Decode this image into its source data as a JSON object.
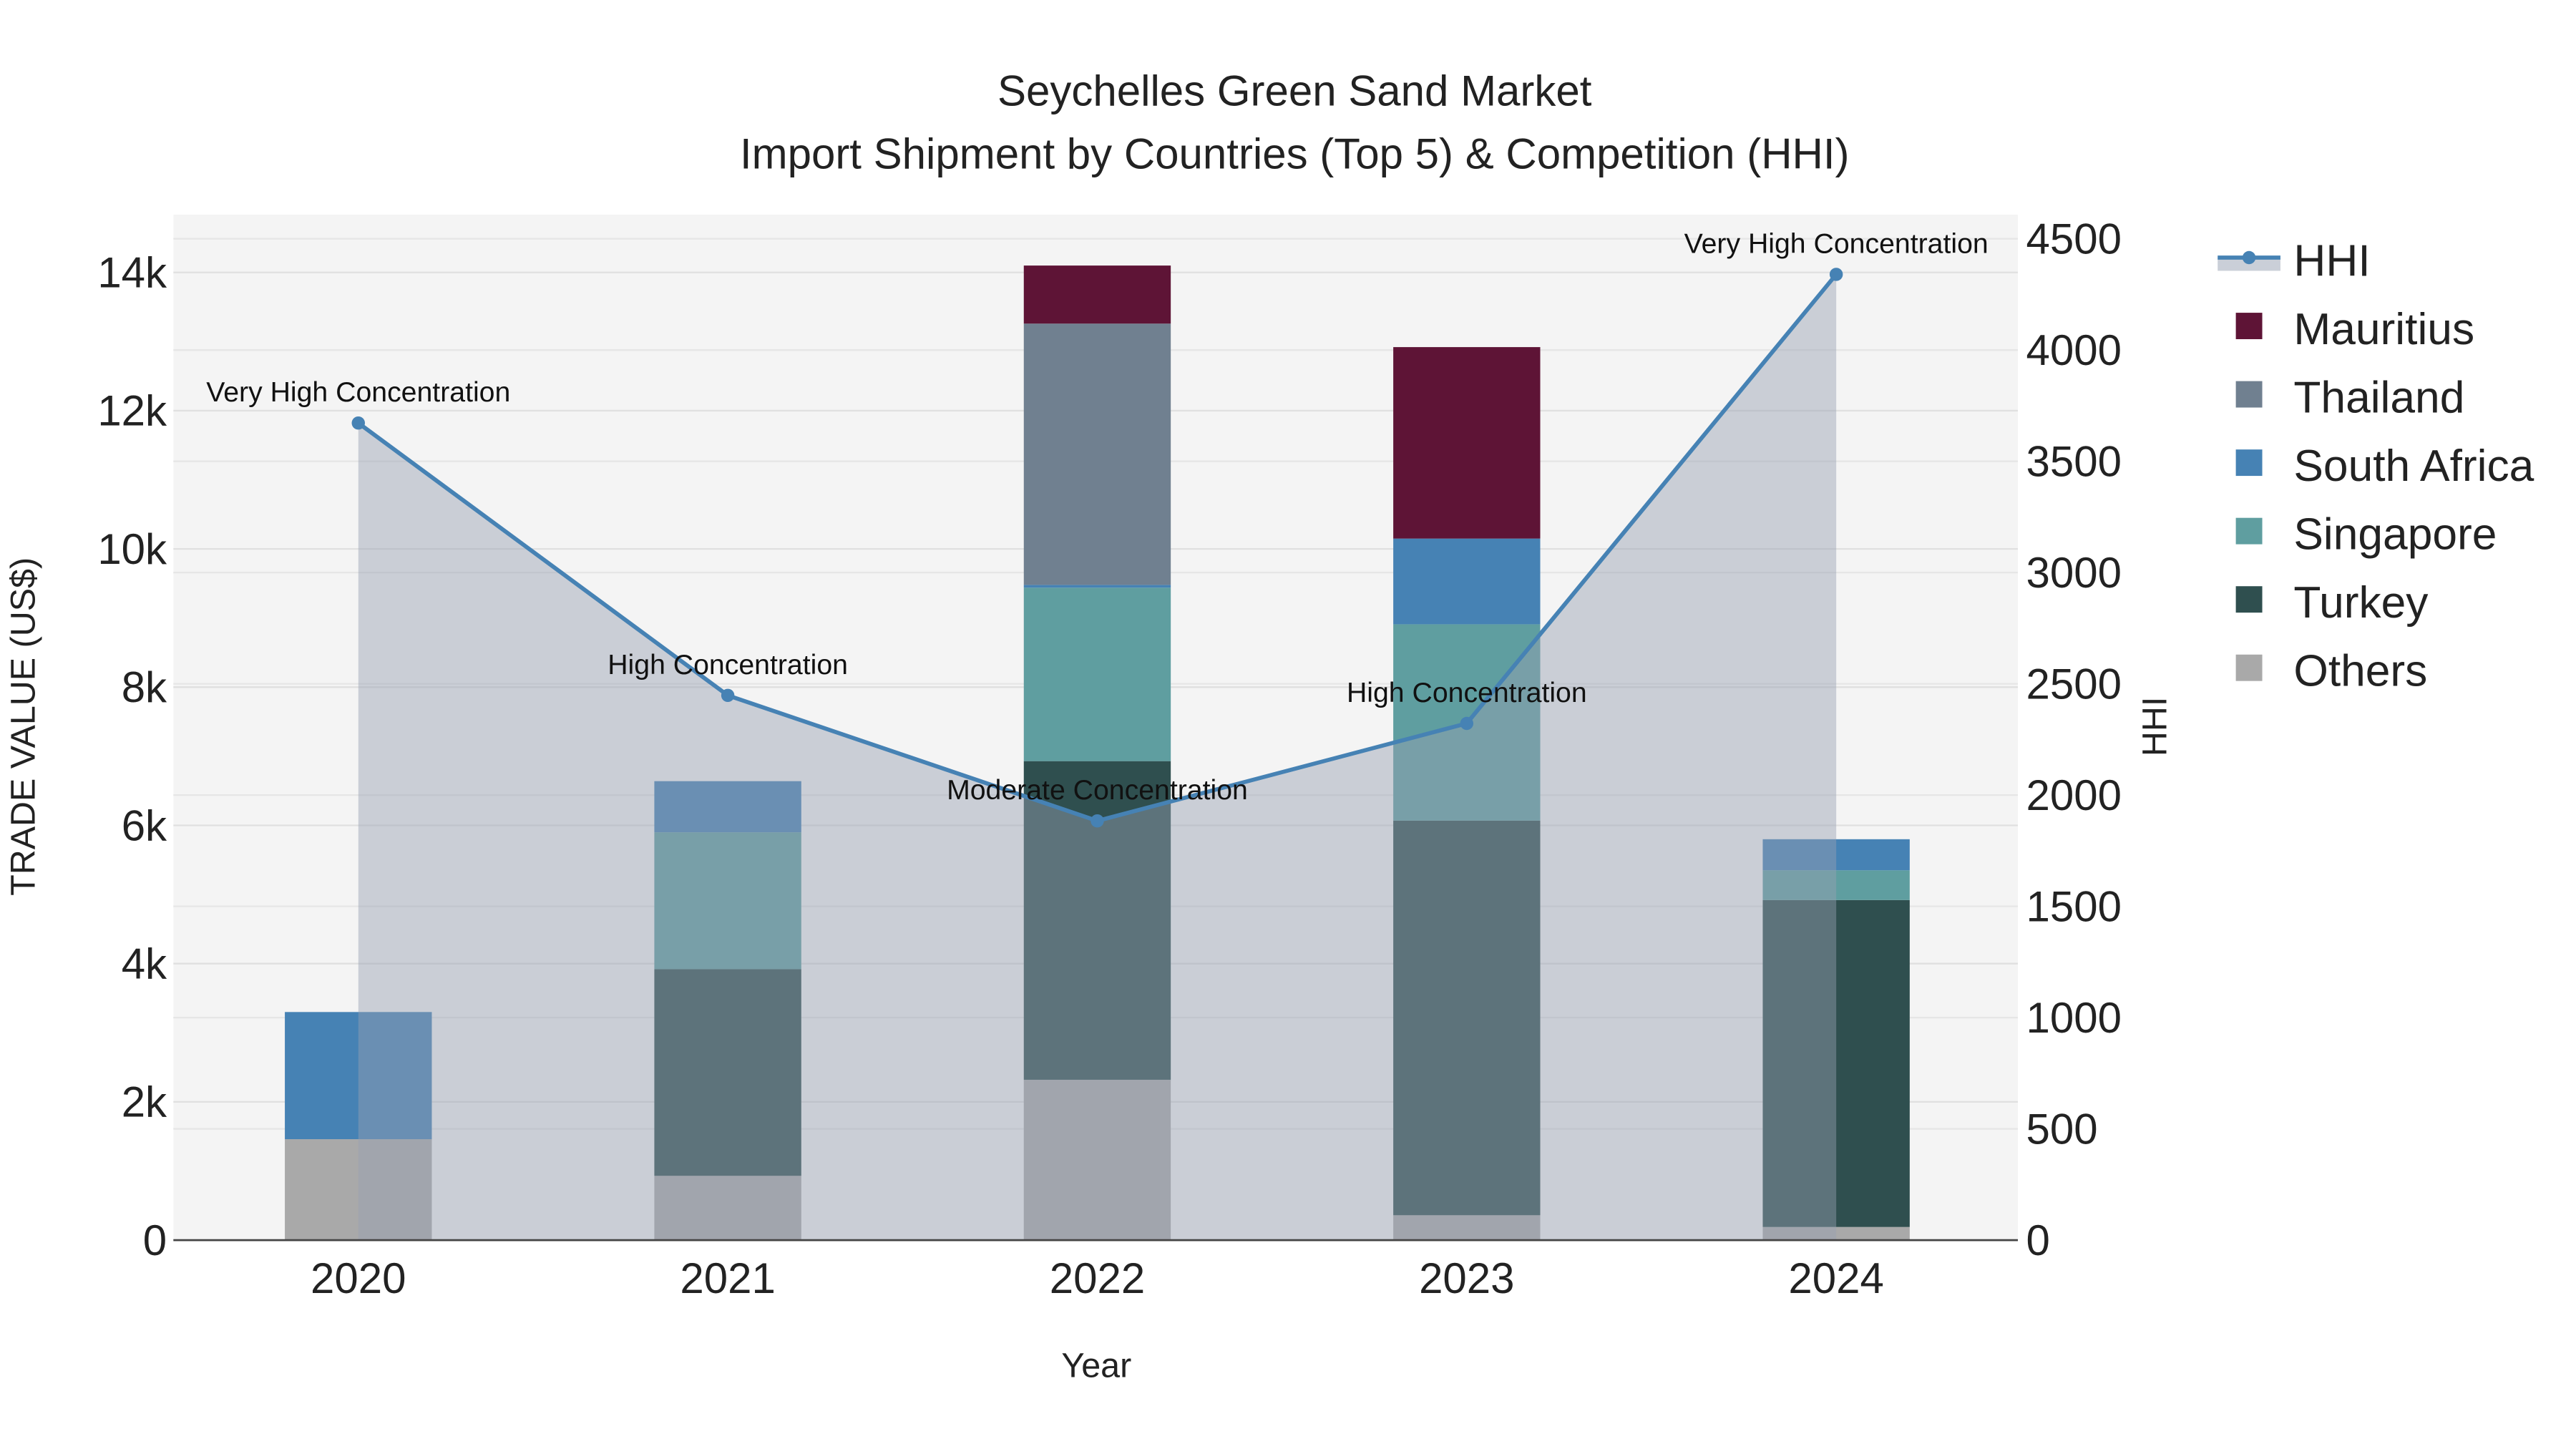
{
  "chart_data": {
    "type": "bar",
    "title": "Seychelles Green Sand Market",
    "subtitle": "Import Shipment by Countries (Top 5) & Competition (HHI)",
    "xlabel": "Year",
    "ylabel": "TRADE VALUE (US$)",
    "y2label": "HHI",
    "categories": [
      "2020",
      "2021",
      "2022",
      "2023",
      "2024"
    ],
    "ylim": [
      0,
      14800
    ],
    "y2lim": [
      0,
      4600
    ],
    "yticks": [
      0,
      2000,
      4000,
      6000,
      8000,
      10000,
      12000,
      14000
    ],
    "ytick_labels": [
      "0",
      "2k",
      "4k",
      "6k",
      "8k",
      "10k",
      "12k",
      "14k"
    ],
    "y2ticks": [
      0,
      500,
      1000,
      1500,
      2000,
      2500,
      3000,
      3500,
      4000,
      4500
    ],
    "y2tick_labels": [
      "0",
      "500",
      "1000",
      "1500",
      "2000",
      "2500",
      "3000",
      "3500",
      "4000",
      "4500"
    ],
    "grid": true,
    "legend_position": "right",
    "stacked": true,
    "series": [
      {
        "name": "Others",
        "color": "#a9a9a9",
        "values": [
          1460,
          930,
          2320,
          360,
          190
        ]
      },
      {
        "name": "Turkey",
        "color": "#2f4f4f",
        "values": [
          0,
          2990,
          4610,
          5710,
          4730
        ]
      },
      {
        "name": "Singapore",
        "color": "#5f9ea0",
        "values": [
          0,
          1980,
          2510,
          2840,
          430
        ]
      },
      {
        "name": "South Africa",
        "color": "#4682b4",
        "values": [
          1840,
          740,
          40,
          1240,
          450
        ]
      },
      {
        "name": "Thailand",
        "color": "#708090",
        "values": [
          0,
          0,
          3780,
          0,
          0
        ]
      },
      {
        "name": "Mauritius",
        "color": "#5e1436",
        "values": [
          0,
          0,
          840,
          2770,
          0
        ]
      }
    ],
    "hhi": {
      "name": "HHI",
      "color": "#4682b4",
      "values": [
        3672,
        2448,
        1884,
        2322,
        4340
      ],
      "annotations": [
        "Very High Concentration",
        "High Concentration",
        "Moderate Concentration",
        "High Concentration",
        "Very High Concentration"
      ]
    },
    "legend_order": [
      "HHI",
      "Mauritius",
      "Thailand",
      "South Africa",
      "Singapore",
      "Turkey",
      "Others"
    ]
  }
}
